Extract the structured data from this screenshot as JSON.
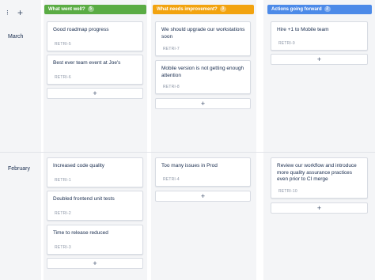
{
  "controls": {
    "sort_icon": "⁝",
    "add_icon": "+"
  },
  "rows": [
    {
      "label": "March"
    },
    {
      "label": "February"
    }
  ],
  "columns": [
    {
      "title": "What went well?",
      "count": "5",
      "color": "#5aac44"
    },
    {
      "title": "What needs improvement?",
      "count": "3",
      "color": "#f2a30f"
    },
    {
      "title": "Actions going forward",
      "count": "2",
      "color": "#4c8ae8"
    }
  ],
  "cards": {
    "r0c0": [
      {
        "title": "Good roadmap progress",
        "key": "RETRI-5"
      },
      {
        "title": "Best ever team event at Joe's",
        "key": "RETRI-6"
      }
    ],
    "r0c1": [
      {
        "title": "We should upgrade our workstations soon",
        "key": "RETRI-7"
      },
      {
        "title": "Mobile version is not getting enough attention",
        "key": "RETRI-8"
      }
    ],
    "r0c2": [
      {
        "title": "Hire +1 to Mobile team",
        "key": "RETRI-9"
      }
    ],
    "r1c0": [
      {
        "title": "Increased code quality",
        "key": "RETRI-1"
      },
      {
        "title": "Doubled frontend unit tests",
        "key": "RETRI-2"
      },
      {
        "title": "Time to release reduced",
        "key": "RETRI-3"
      }
    ],
    "r1c1": [
      {
        "title": "Too many issues in Prod",
        "key": "RETRI-4"
      }
    ],
    "r1c2": [
      {
        "title": "Review our workflow and introduce more quality assurance practices even prior to CI merge",
        "key": "RETRI-10"
      }
    ]
  },
  "add_label": "+"
}
